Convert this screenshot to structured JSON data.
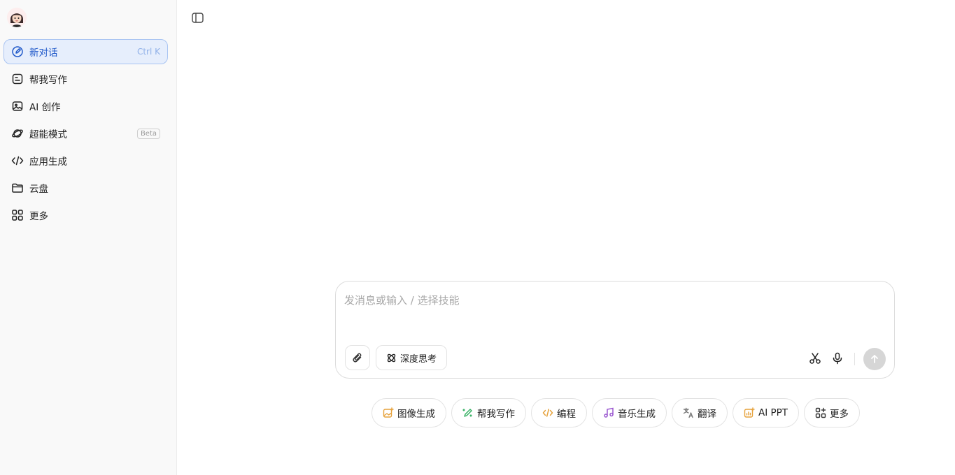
{
  "sidebar": {
    "items": [
      {
        "label": "新对话",
        "shortcut": "Ctrl K",
        "icon": "edit-icon",
        "active": true
      },
      {
        "label": "帮我写作",
        "icon": "write-icon"
      },
      {
        "label": "AI 创作",
        "icon": "image-icon"
      },
      {
        "label": "超能模式",
        "badge": "Beta",
        "icon": "planet-icon"
      },
      {
        "label": "应用生成",
        "icon": "code-icon"
      },
      {
        "label": "云盘",
        "icon": "folder-icon"
      },
      {
        "label": "更多",
        "icon": "grid-icon"
      }
    ]
  },
  "composer": {
    "placeholder": "发消息或输入 / 选择技能",
    "think_label": "深度思考"
  },
  "skills": [
    {
      "label": "图像生成",
      "icon": "image-gen-icon",
      "color": "#e6a23c"
    },
    {
      "label": "帮我写作",
      "icon": "pen-icon",
      "color": "#2fae5e"
    },
    {
      "label": "编程",
      "icon": "code-icon",
      "color": "#e6a23c"
    },
    {
      "label": "音乐生成",
      "icon": "music-icon",
      "color": "#9b59d0"
    },
    {
      "label": "翻译",
      "icon": "translate-icon",
      "color": "#7a7a7a"
    },
    {
      "label": "AI PPT",
      "icon": "ppt-icon",
      "color": "#e6a23c"
    },
    {
      "label": "更多",
      "icon": "more-grid-icon",
      "color": "#333333"
    }
  ],
  "colors": {
    "accent": "#1f58c9",
    "active_bg": "#e6eefc",
    "send_disabled": "#d6d6d6"
  }
}
